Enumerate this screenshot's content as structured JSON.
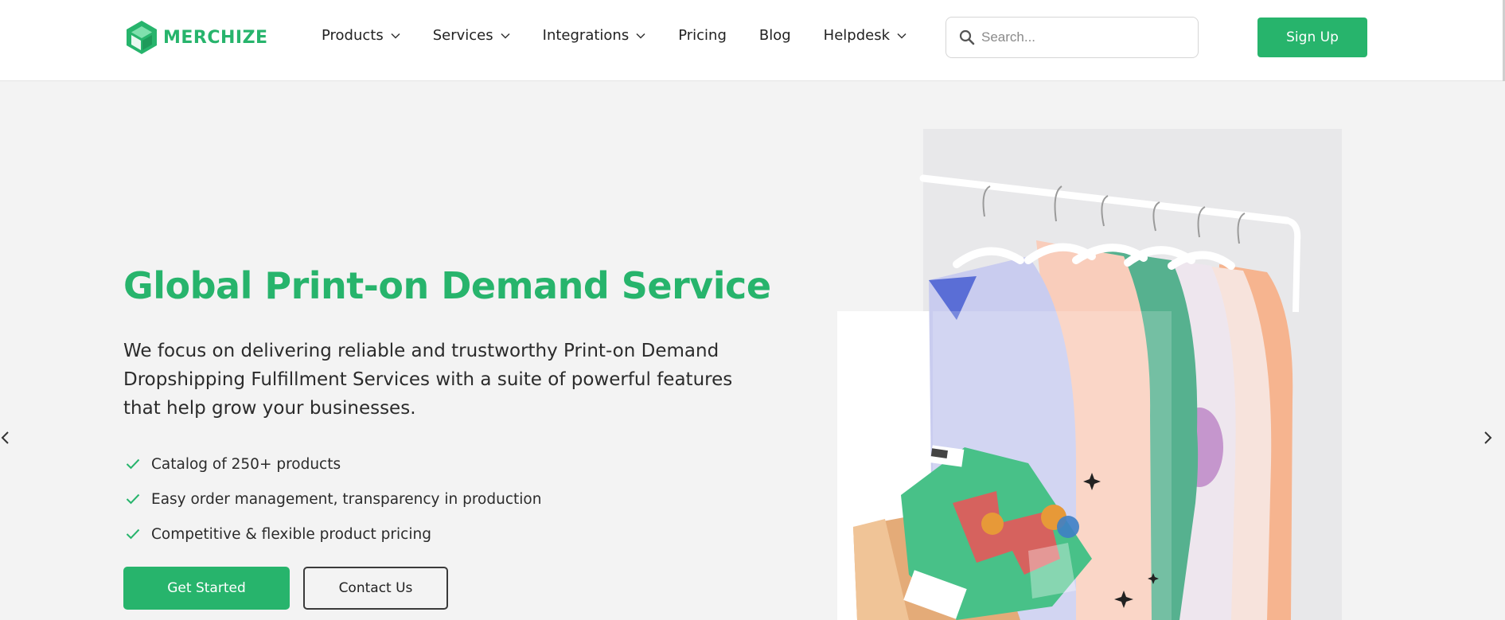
{
  "brand": {
    "name": "MERCHIZE",
    "color": "#27b46c"
  },
  "nav": {
    "items": [
      {
        "label": "Products",
        "has_dropdown": true
      },
      {
        "label": "Services",
        "has_dropdown": true
      },
      {
        "label": "Integrations",
        "has_dropdown": true
      },
      {
        "label": "Pricing",
        "has_dropdown": false
      },
      {
        "label": "Blog",
        "has_dropdown": false
      },
      {
        "label": "Helpdesk",
        "has_dropdown": true
      }
    ]
  },
  "search": {
    "placeholder": "Search...",
    "value": "",
    "icon": "search-icon"
  },
  "header": {
    "signup_label": "Sign Up"
  },
  "hero": {
    "title": "Global Print-on Demand Service",
    "description": "We focus on delivering reliable and trustworthy Print-on Demand Dropshipping Fulfillment Services with a suite of powerful features that help grow your businesses.",
    "features": [
      "Catalog of 250+ products",
      "Easy order management, transparency in production",
      "Competitive & flexible product pricing"
    ],
    "cta_primary": "Get Started",
    "cta_secondary": "Contact Us"
  },
  "carousel": {
    "prev_icon": "chevron-left-icon",
    "next_icon": "chevron-right-icon"
  }
}
